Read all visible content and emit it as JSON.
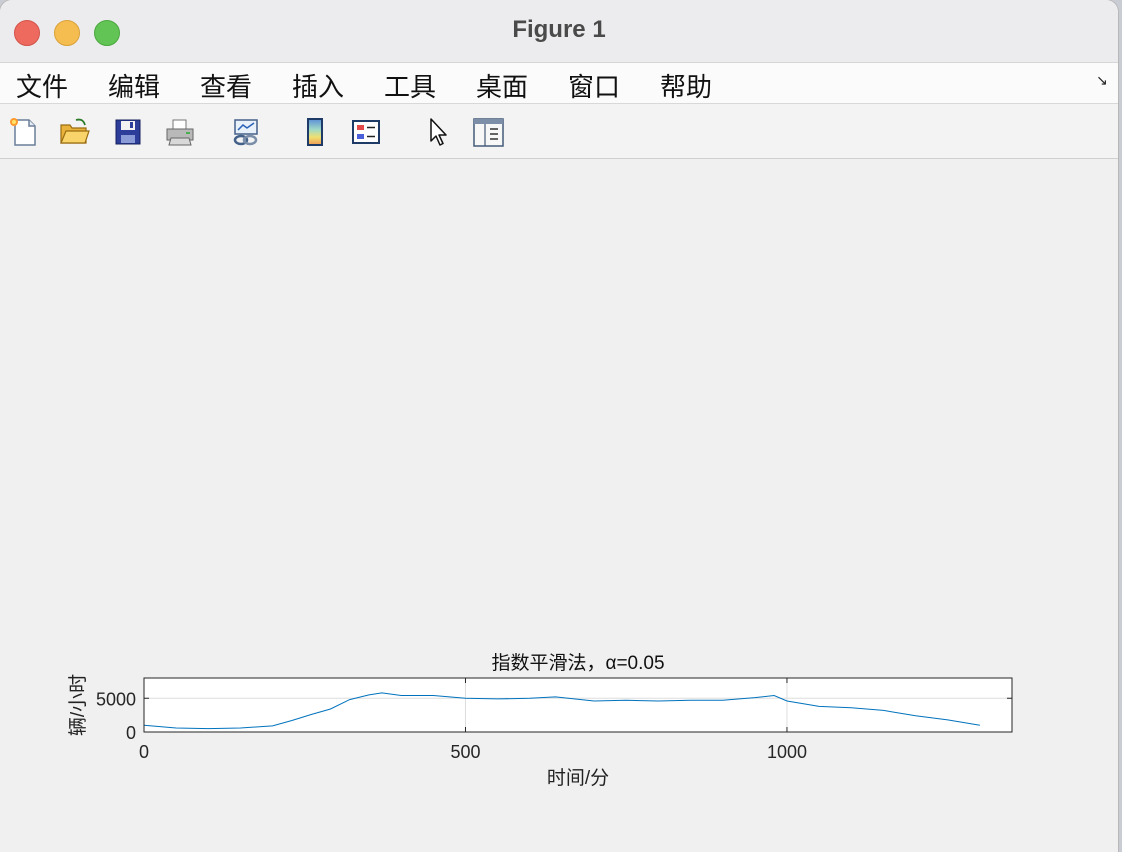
{
  "window": {
    "title": "Figure 1"
  },
  "menu": {
    "items": [
      "文件",
      "编辑",
      "查看",
      "插入",
      "工具",
      "桌面",
      "窗口",
      "帮助"
    ]
  },
  "toolbar": {
    "buttons": [
      "new-figure-icon",
      "open-file-icon",
      "save-icon",
      "print-icon",
      "link-plot-icon",
      "colorbar-icon",
      "legend-icon",
      "edit-plot-pointer-icon",
      "property-editor-icon"
    ]
  },
  "chart_data": {
    "type": "line",
    "title": "指数平滑法，α=0.05",
    "xlabel": "时间/分",
    "ylabel": "辆/小时",
    "xlim": [
      0,
      1350
    ],
    "ylim": [
      0,
      8000
    ],
    "xticks": [
      0,
      500,
      1000
    ],
    "yticks": [
      0,
      5000
    ],
    "xtick_labels": [
      "0",
      "500",
      "1000"
    ],
    "ytick_labels": [
      "0",
      "5000"
    ],
    "grid": true,
    "color": "#0072bd",
    "series": [
      {
        "x": [
          0,
          50,
          100,
          150,
          200,
          230,
          260,
          290,
          320,
          350,
          370,
          400,
          450,
          500,
          550,
          600,
          640,
          700,
          750,
          800,
          850,
          900,
          950,
          980,
          1000,
          1050,
          1100,
          1150,
          1200,
          1250,
          1300
        ],
        "y": [
          1000,
          600,
          500,
          600,
          900,
          1700,
          2600,
          3400,
          4800,
          5500,
          5800,
          5400,
          5400,
          5000,
          4900,
          5000,
          5200,
          4600,
          4700,
          4600,
          4700,
          4700,
          5100,
          5400,
          4600,
          3800,
          3600,
          3200,
          2400,
          1800,
          1000
        ]
      }
    ]
  }
}
